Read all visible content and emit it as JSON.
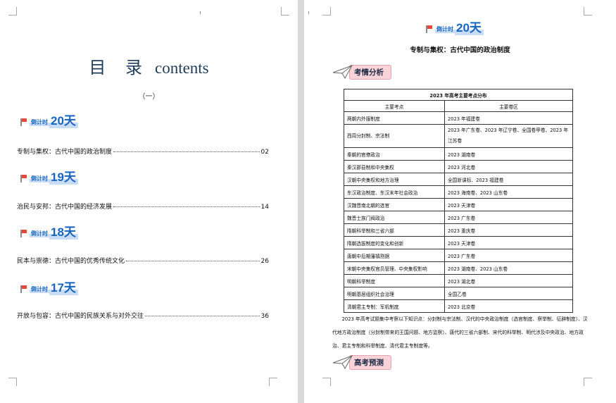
{
  "page1": {
    "title_cn": "目 录",
    "title_en": "contents",
    "subtitle": "（一）",
    "sections": [
      {
        "badge_label": "倒计时",
        "badge_num": "20天",
        "entry": "专制与集权：古代中国的政治制度",
        "page": "02"
      },
      {
        "badge_label": "倒计时",
        "badge_num": "19天",
        "entry": "治民与安邦：古代中国的经济发展",
        "page": "14"
      },
      {
        "badge_label": "倒计时",
        "badge_num": "18天",
        "entry": "民本与崇德：古代中国的优秀传统文化",
        "page": "26"
      },
      {
        "badge_label": "倒计时",
        "badge_num": "17天",
        "entry": "开放与包容：古代中国的民族关系与对外交往",
        "page": "36"
      }
    ]
  },
  "page2": {
    "badge_label": "倒计时",
    "badge_num": "20天",
    "title": "专制与集权：古代中国的政治制度",
    "section1": "考情分析",
    "table": {
      "caption": "2023 年高考主要考点分布",
      "headers": [
        "主要考点",
        "主要卷区"
      ],
      "rows": [
        [
          "两朝内外服制度",
          "2023 年福建卷"
        ],
        [
          "西周分封制、宗法制",
          "2023 年广东卷、2023 年辽宁卷、全国卷甲卷、2023 年江苏卷"
        ],
        [
          "秦朝的官僚政治",
          "2023 湖南卷"
        ],
        [
          "秦汉郡县制和中央集权",
          "2023 河北卷"
        ],
        [
          "汉朝中央集权和地方治理",
          "全国新课标、2023 福建卷"
        ],
        [
          "东汉政治制度、东汉末年社会政治",
          "2023 海南卷、2023 山东卷"
        ],
        [
          "汉魏晋南北朝的选官",
          "2023 天津卷"
        ],
        [
          "魏晋士族门阀政治",
          "2023 广东卷"
        ],
        [
          "隋朝科举制和三省六部",
          "2023 重庆卷"
        ],
        [
          "隋朝选拔制度的变化和创新",
          "2023 天津卷"
        ],
        [
          "唐朝中后期藩镇割据",
          "2023 广东卷"
        ],
        [
          "宋朝中央集权官员管理、中央集权影响",
          "2023 湖南卷、2023 山东卷"
        ],
        [
          "明朝科举制度",
          "2023 湖北卷"
        ],
        [
          "明朝基层组织社会治理",
          "全国乙卷"
        ],
        [
          "清朝君主专制：军机制度",
          "2023 北京卷"
        ]
      ]
    },
    "summary": "2023 年高考试题集中考察以下知识点：分封制与宗法制、汉代的中央政治制度（选官制度、察举制、征辟制度）、汉代地方政治制度（分封制带来的王国问题、地方监察）、唐代的三省六部制、宋代的科举制、明代涉及中央政治、地方政治、君主专制和科举制度、清代君主专制度等。",
    "section2": "高考预测"
  }
}
